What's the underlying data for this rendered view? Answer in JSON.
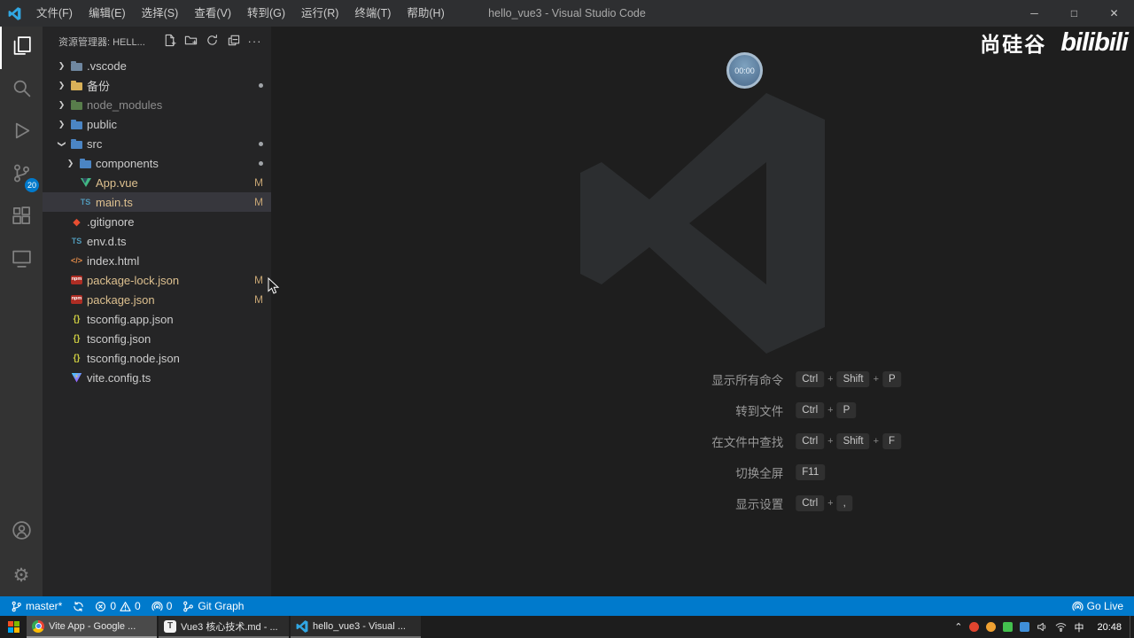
{
  "window": {
    "title": "hello_vue3 - Visual Studio Code"
  },
  "menu_bar": {
    "items": [
      "文件(F)",
      "编辑(E)",
      "选择(S)",
      "查看(V)",
      "转到(G)",
      "运行(R)",
      "终端(T)",
      "帮助(H)"
    ]
  },
  "window_controls": {
    "minimize": "─",
    "maximize": "□",
    "close": "✕"
  },
  "activity_bar": {
    "top": [
      {
        "name": "explorer",
        "active": true
      },
      {
        "name": "search",
        "active": false
      },
      {
        "name": "run-debug",
        "active": false
      },
      {
        "name": "source-control",
        "active": false,
        "badge": "20"
      },
      {
        "name": "extensions",
        "active": false
      },
      {
        "name": "remote-explorer",
        "active": false
      }
    ],
    "bottom": [
      {
        "name": "account"
      },
      {
        "name": "settings"
      }
    ]
  },
  "explorer": {
    "header": "资源管理器: HELL...",
    "actions": [
      "new-file",
      "new-folder",
      "refresh",
      "collapse-all",
      "more"
    ],
    "tree": [
      {
        "label": ".vscode",
        "level": 0,
        "icon": "folder-vscode",
        "chevron": "collapsed"
      },
      {
        "label": "备份",
        "level": 0,
        "icon": "folder-yellow",
        "chevron": "collapsed",
        "dot": true
      },
      {
        "label": "node_modules",
        "level": 0,
        "icon": "folder-green",
        "chevron": "collapsed",
        "dim": true
      },
      {
        "label": "public",
        "level": 0,
        "icon": "folder-blue",
        "chevron": "collapsed"
      },
      {
        "label": "src",
        "level": 0,
        "icon": "folder-blue",
        "chevron": "expanded",
        "dot": true
      },
      {
        "label": "components",
        "level": 1,
        "icon": "folder-blue",
        "chevron": "collapsed",
        "dot": true
      },
      {
        "label": "App.vue",
        "level": 1,
        "icon": "vue",
        "badge": "M",
        "modified": true
      },
      {
        "label": "main.ts",
        "level": 1,
        "icon": "ts",
        "badge": "M",
        "modified": true,
        "selected": true
      },
      {
        "label": ".gitignore",
        "level": 0,
        "icon": "git"
      },
      {
        "label": "env.d.ts",
        "level": 0,
        "icon": "ts"
      },
      {
        "label": "index.html",
        "level": 0,
        "icon": "html"
      },
      {
        "label": "package-lock.json",
        "level": 0,
        "icon": "npm",
        "badge": "M",
        "modified": true
      },
      {
        "label": "package.json",
        "level": 0,
        "icon": "npm",
        "badge": "M",
        "modified": true
      },
      {
        "label": "tsconfig.app.json",
        "level": 0,
        "icon": "json-braces"
      },
      {
        "label": "tsconfig.json",
        "level": 0,
        "icon": "json-braces"
      },
      {
        "label": "tsconfig.node.json",
        "level": 0,
        "icon": "json-braces"
      },
      {
        "label": "vite.config.ts",
        "level": 0,
        "icon": "vite"
      }
    ]
  },
  "watermark": {
    "shortcuts": [
      {
        "label": "显示所有命令",
        "keys": [
          "Ctrl",
          "Shift",
          "P"
        ]
      },
      {
        "label": "转到文件",
        "keys": [
          "Ctrl",
          "P"
        ]
      },
      {
        "label": "在文件中查找",
        "keys": [
          "Ctrl",
          "Shift",
          "F"
        ]
      },
      {
        "label": "切换全屏",
        "keys": [
          "F11"
        ]
      },
      {
        "label": "显示设置",
        "keys": [
          "Ctrl",
          ","
        ]
      }
    ]
  },
  "overlays": {
    "brand_text": "尚硅谷",
    "brand_logo": "bilibili",
    "timer": "00:00"
  },
  "status_bar": {
    "branch": "master*",
    "errors": "0",
    "warnings": "0",
    "ports": "0",
    "git_graph": "Git Graph",
    "go_live": "Go Live"
  },
  "taskbar": {
    "apps": [
      {
        "icon": "chrome",
        "label": "Vite App - Google ...",
        "active": true
      },
      {
        "icon": "typora",
        "label": "Vue3 核心技术.md - ...",
        "active": false
      },
      {
        "icon": "vscode",
        "label": "hello_vue3 - Visual ...",
        "active": false
      }
    ],
    "tray": [
      {
        "name": "hidden-icons-chevron",
        "shape": "text",
        "glyph": "⌃",
        "color": "#e8e8e8"
      },
      {
        "name": "app-red",
        "shape": "circle",
        "color": "#e0452f"
      },
      {
        "name": "app-orange",
        "shape": "circle",
        "color": "#f0a132"
      },
      {
        "name": "app-green",
        "shape": "square",
        "color": "#43c04e"
      },
      {
        "name": "app-blue",
        "shape": "square",
        "color": "#3f8fd9"
      },
      {
        "name": "volume",
        "shape": "svg-volume",
        "color": "#d8d8d8"
      },
      {
        "name": "network",
        "shape": "svg-network",
        "color": "#d8d8d8"
      },
      {
        "name": "ime-chinese",
        "shape": "text",
        "glyph": "中",
        "color": "#ffffff"
      }
    ],
    "time": "20:48"
  }
}
